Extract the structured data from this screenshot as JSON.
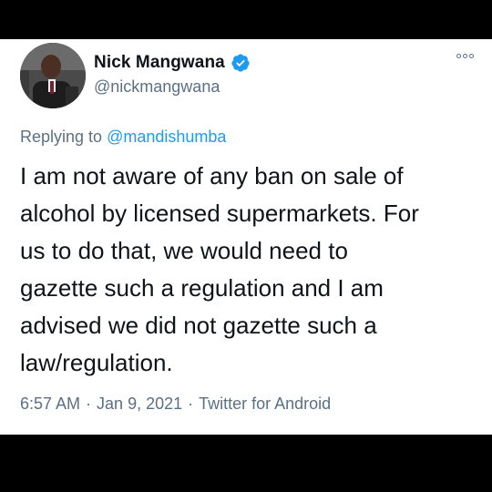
{
  "tweet": {
    "author": {
      "display_name": "Nick Mangwana",
      "handle": "@nickmangwana",
      "verified": true,
      "avatar_icon": "profile-photo"
    },
    "more_icon": "more-options-icon",
    "reply_prefix": "Replying to",
    "reply_to": "@mandishumba",
    "text": "I am not aware of any ban on sale of\nalcohol by licensed supermarkets. For\nus to do that, we would need to\ngazette such a regulation and I am\nadvised we did not gazette such a\nlaw/regulation.",
    "time": "6:57 AM",
    "date": "Jan 9, 2021",
    "separator": "·",
    "source": "Twitter for Android"
  },
  "colors": {
    "background": "#000000",
    "card": "#ffffff",
    "text_primary": "#0f1419",
    "text_secondary": "#5b7083",
    "link": "#1d9bf0",
    "verified": "#1d9bf0"
  }
}
